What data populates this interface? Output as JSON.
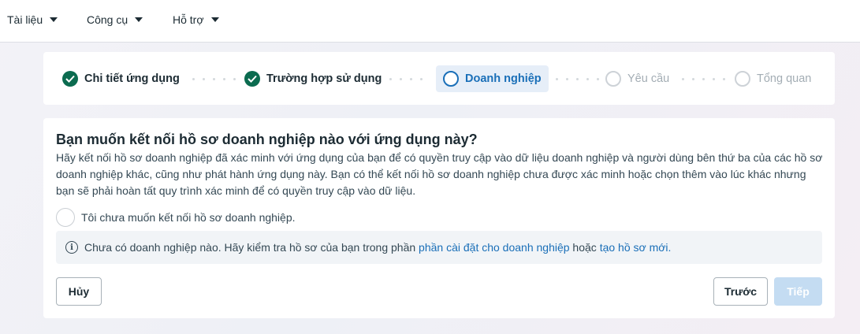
{
  "nav": {
    "items": [
      {
        "label": "Tài liệu"
      },
      {
        "label": "Công cụ"
      },
      {
        "label": "Hỗ trợ"
      }
    ]
  },
  "stepper": {
    "steps": [
      {
        "label": "Chi tiết ứng dụng",
        "state": "done"
      },
      {
        "label": "Trường hợp sử dụng",
        "state": "done"
      },
      {
        "label": "Doanh nghiệp",
        "state": "current"
      },
      {
        "label": "Yêu cầu",
        "state": "future"
      },
      {
        "label": "Tổng quan",
        "state": "future"
      }
    ]
  },
  "main": {
    "title": "Bạn muốn kết nối hồ sơ doanh nghiệp nào với ứng dụng này?",
    "description": "Hãy kết nối hồ sơ doanh nghiệp đã xác minh với ứng dụng của bạn để có quyền truy cập vào dữ liệu doanh nghiệp và người dùng bên thứ ba của các hồ sơ doanh nghiệp khác, cũng như phát hành ứng dụng này. Bạn có thể kết nối hồ sơ doanh nghiệp chưa được xác minh hoặc chọn thêm vào lúc khác nhưng bạn sẽ phải hoàn tất quy trình xác minh để có quyền truy cập vào dữ liệu.",
    "radio_label": "Tôi chưa muốn kết nối hồ sơ doanh nghiệp.",
    "info": {
      "prefix": "Chưa có doanh nghiệp nào. Hãy kiểm tra hồ sơ của bạn trong phần ",
      "link1": "phần cài đặt cho doanh nghiệp",
      "middle": " hoặc ",
      "link2": "tạo hồ sơ mới."
    },
    "buttons": {
      "cancel": "Hủy",
      "previous": "Trước",
      "next": "Tiếp"
    }
  },
  "colors": {
    "accent": "#1a6fb8",
    "done": "#0b6b4f",
    "next_disabled": "#c4dcf2"
  }
}
